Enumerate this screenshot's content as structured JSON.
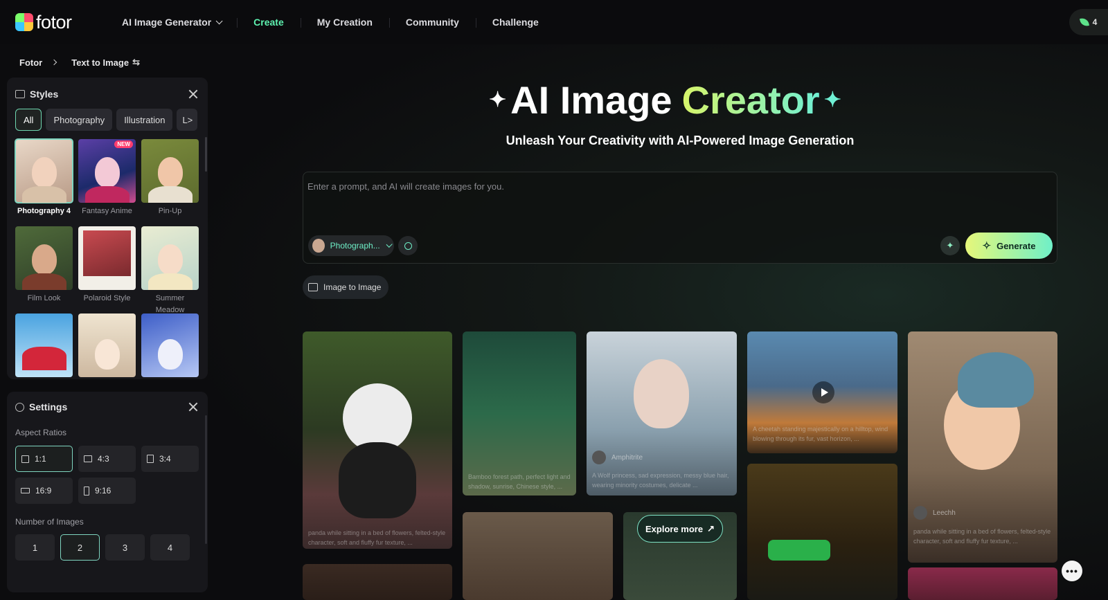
{
  "brand": {
    "name": "fotor",
    "logo_icon": "fotor-logo"
  },
  "nav": {
    "items": [
      {
        "label": "AI Image Generator",
        "has_dropdown": true,
        "active": false
      },
      {
        "label": "Create",
        "active": true
      },
      {
        "label": "My Creation",
        "active": false
      },
      {
        "label": "Community",
        "active": false
      },
      {
        "label": "Challenge",
        "active": false
      }
    ],
    "credits": "4",
    "credits_icon": "leaf-icon"
  },
  "breadcrumb": {
    "root": "Fotor",
    "current": "Text to Image"
  },
  "styles_panel": {
    "title": "Styles",
    "chips": [
      {
        "label": "All",
        "active": true
      },
      {
        "label": "Photography",
        "active": false
      },
      {
        "label": "Illustration",
        "active": false
      },
      {
        "label": "L",
        "active": false
      }
    ],
    "items": [
      {
        "label": "Photography 4",
        "selected": true,
        "badge": ""
      },
      {
        "label": "Fantasy Anime",
        "selected": false,
        "badge": "NEW"
      },
      {
        "label": "Pin-Up",
        "selected": false,
        "badge": ""
      },
      {
        "label": "Film Look",
        "selected": false,
        "badge": ""
      },
      {
        "label": "Polaroid Style",
        "selected": false,
        "badge": ""
      },
      {
        "label": "Summer Meadow",
        "selected": false,
        "badge": ""
      },
      {
        "label": "",
        "selected": false,
        "badge": ""
      },
      {
        "label": "",
        "selected": false,
        "badge": ""
      },
      {
        "label": "",
        "selected": false,
        "badge": ""
      }
    ]
  },
  "settings_panel": {
    "title": "Settings",
    "aspect_label": "Aspect Ratios",
    "ratios": [
      {
        "label": "1:1",
        "active": true
      },
      {
        "label": "4:3",
        "active": false
      },
      {
        "label": "3:4",
        "active": false
      },
      {
        "label": "16:9",
        "active": false
      },
      {
        "label": "9:16",
        "active": false
      }
    ],
    "num_label": "Number of Images",
    "numbers": [
      {
        "label": "1",
        "active": false
      },
      {
        "label": "2",
        "active": true
      },
      {
        "label": "3",
        "active": false
      },
      {
        "label": "4",
        "active": false
      }
    ]
  },
  "hero": {
    "title_white": "AI Image",
    "title_gradient": "Creator",
    "subtitle": "Unleash Your Creativity with AI-Powered Image Generation"
  },
  "prompt": {
    "placeholder": "Enter a prompt, and AI will create images for you.",
    "value": "",
    "style_value": "Photograph...",
    "generate_label": "Generate"
  },
  "image_to_image": {
    "label": "Image to Image"
  },
  "gallery": {
    "cards": [
      {
        "name": "panda",
        "caption": "panda while sitting in a bed of flowers, felted-style character, soft and fluffy fur texture, ...",
        "author": ""
      },
      {
        "name": "bamboo",
        "caption": "Bamboo forest path, perfect light and shadow, sunrise, Chinese style, ...",
        "author": ""
      },
      {
        "name": "wolf-princess",
        "caption": "A Wolf princess, sad expression, messy blue hair, wearing minority costumes, delicate ...",
        "author": "Amphitrite"
      },
      {
        "name": "cheetah",
        "caption": "A cheetah standing majestically on a hilltop, wind blowing through its fur, vast horizon, ...",
        "author": ""
      },
      {
        "name": "pearl-girl",
        "caption": "panda while sitting in a bed of flowers, felted-style character, soft and fluffy fur texture, ...",
        "author": "Leechh"
      },
      {
        "name": "cowboy",
        "caption": "",
        "author": ""
      },
      {
        "name": "city",
        "caption": "",
        "author": ""
      },
      {
        "name": "cyber",
        "caption": "",
        "author": ""
      }
    ],
    "explore_label": "Explore more"
  },
  "chat": {
    "label": "•••"
  }
}
